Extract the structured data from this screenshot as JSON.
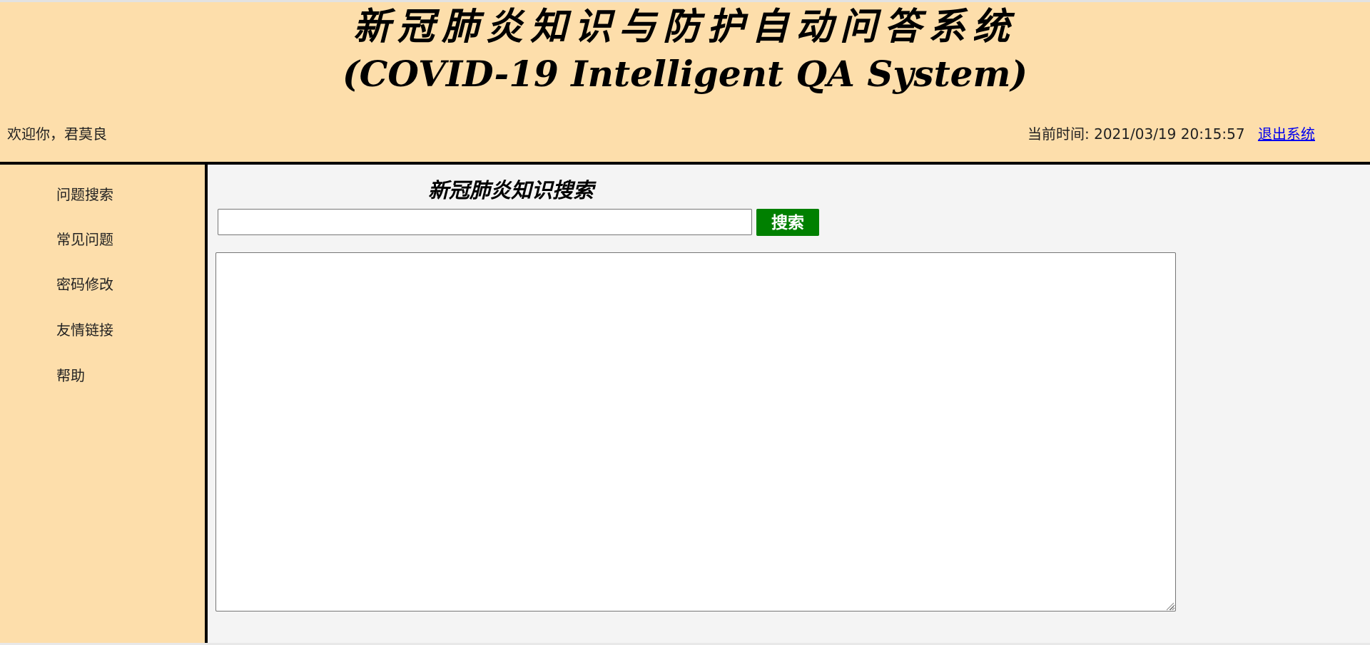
{
  "header": {
    "title": "新冠肺炎知识与防护自动问答系统",
    "subtitle": "(COVID-19 Intelligent QA System)",
    "welcome_text": "欢迎你，君莫良",
    "clock_label": "当前时间: ",
    "clock_value": "2021/03/19 20:15:57",
    "logout_label": "退出系统"
  },
  "sidebar": {
    "items": [
      {
        "label": "问题搜索"
      },
      {
        "label": "常见问题"
      },
      {
        "label": "密码修改"
      },
      {
        "label": "友情链接"
      },
      {
        "label": "帮助"
      }
    ]
  },
  "search": {
    "title": "新冠肺炎知识搜索",
    "input_value": "",
    "button_label": "搜索"
  },
  "answer": {
    "value": ""
  },
  "colors": {
    "header_bg": "#fddeab",
    "main_bg": "#f4f4f4",
    "button_bg": "#008000",
    "link": "#0000ee"
  }
}
